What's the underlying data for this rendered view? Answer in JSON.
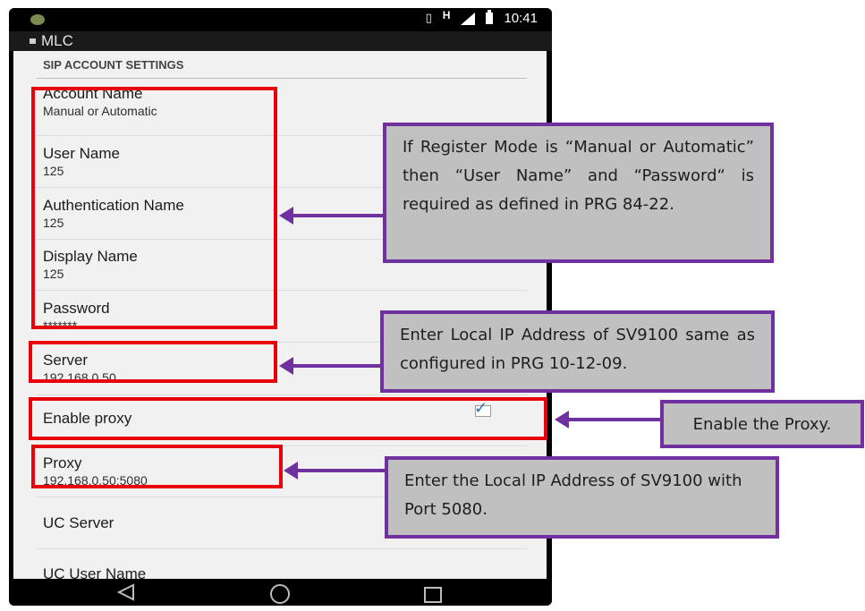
{
  "status_bar": {
    "vibrate_icon": "vibrate-icon",
    "network_type": "H",
    "time": "10:41"
  },
  "app_bar": {
    "title": "MLC"
  },
  "settings": {
    "section_title": "SIP ACCOUNT SETTINGS",
    "items": [
      {
        "title": "Account Name",
        "summary": "Manual or Automatic"
      },
      {
        "title": "User Name",
        "summary": "125"
      },
      {
        "title": "Authentication Name",
        "summary": "125"
      },
      {
        "title": "Display Name",
        "summary": "125"
      },
      {
        "title": "Password",
        "summary": "*******"
      },
      {
        "title": "Server",
        "summary": "192.168.0.50"
      },
      {
        "title": "Enable proxy",
        "checked": true
      },
      {
        "title": "Proxy",
        "summary": "192.168.0.50:5080"
      },
      {
        "title": "UC Server"
      },
      {
        "title": "UC User Name"
      }
    ]
  },
  "callouts": {
    "credentials": "If Register Mode is “Manual or Automatic” then “User Name” and “Password“ is required as defined in PRG 84-22.",
    "server": "Enter Local IP Address of SV9100 same as configured in PRG 10-12-09.",
    "proxy_enable": "Enable the Proxy.",
    "proxy": "Enter the Local IP Address of SV9100 with Port 5080."
  },
  "colors": {
    "highlight_box": "#e8000b",
    "callout_border": "#7030a0",
    "callout_fill": "#c0c0c0"
  }
}
